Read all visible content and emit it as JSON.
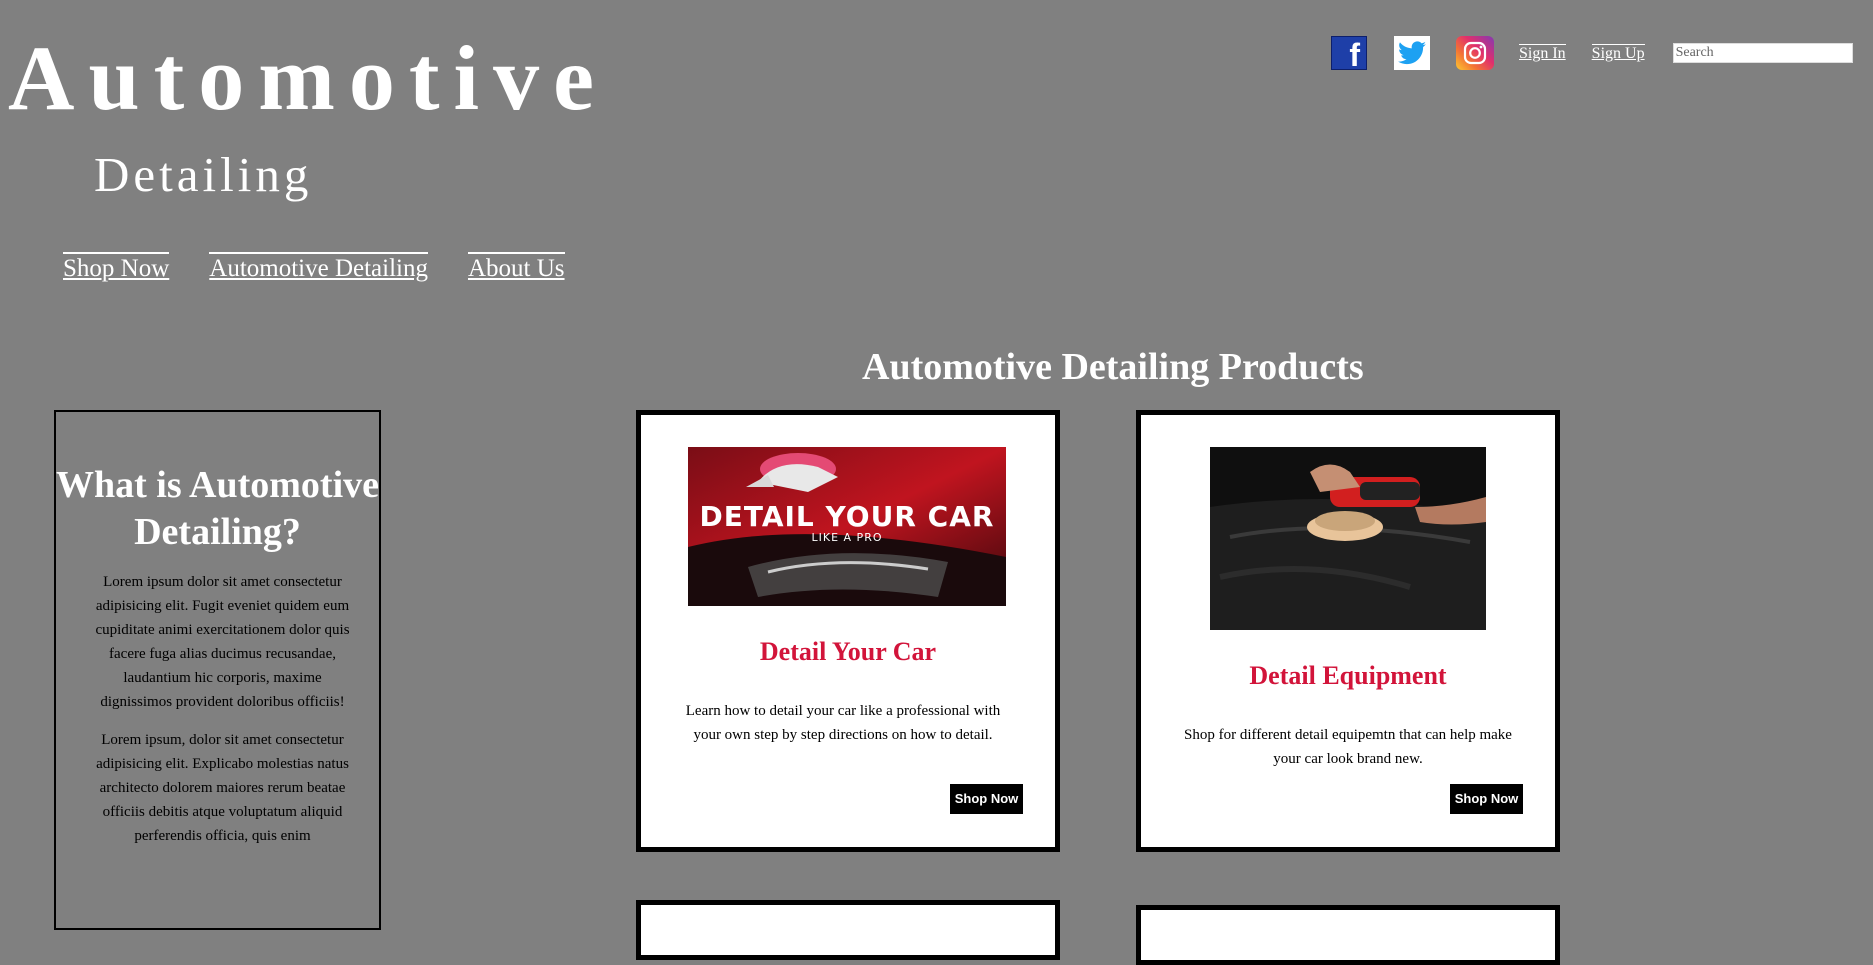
{
  "header": {
    "title_main": "Automotive",
    "title_sub": "Detailing"
  },
  "nav": {
    "items": [
      "Shop Now",
      "Automotive Detailing",
      "About Us"
    ]
  },
  "top_bar": {
    "social_icons": [
      "facebook-icon",
      "twitter-icon",
      "instagram-icon"
    ],
    "sign_in": "Sign In",
    "sign_up": "Sign Up",
    "search_placeholder": "Search",
    "search_value": ""
  },
  "sidebar": {
    "heading": "What is Automotive Detailing?",
    "paragraphs": [
      "Lorem ipsum dolor sit amet consectetur adipisicing elit. Fugit eveniet quidem eum cupiditate animi exercitationem dolor quis facere fuga alias ducimus recusandae, laudantium hic corporis, maxime dignissimos provident doloribus officiis!",
      "Lorem ipsum, dolor sit amet consectetur adipisicing elit. Explicabo molestias natus architecto dolorem maiores rerum beatae officiis debitis atque voluptatum aliquid perferendis officia, quis enim"
    ]
  },
  "products": {
    "heading": "Automotive Detailing Products",
    "cards": [
      {
        "image_text_main": "DETAIL YOUR CAR",
        "image_text_sub": "LIKE A PRO",
        "title": "Detail Your Car",
        "description": "Learn how to detail your car like a professional with your own step by step directions on how to detail.",
        "button": "Shop Now"
      },
      {
        "title": "Detail Equipment",
        "description": "Shop for different detail equipemtn that can help make your car look brand new.",
        "button": "Shop Now"
      }
    ]
  },
  "colors": {
    "background": "#808080",
    "card_title": "#d2143a",
    "button_bg": "#000000",
    "facebook": "#1e3fa8"
  }
}
